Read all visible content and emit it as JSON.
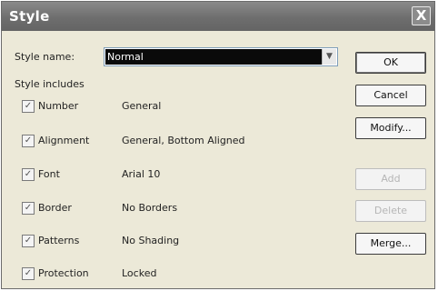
{
  "window": {
    "title": "Style",
    "close_glyph": "X"
  },
  "style_name": {
    "label": "Style name:",
    "value": "Normal"
  },
  "includes_label": "Style includes",
  "options": [
    {
      "label": "Number",
      "value": "General",
      "checked": true
    },
    {
      "label": "Alignment",
      "value": "General, Bottom Aligned",
      "checked": true
    },
    {
      "label": "Font",
      "value": "Arial 10",
      "checked": true
    },
    {
      "label": "Border",
      "value": "No Borders",
      "checked": true
    },
    {
      "label": "Patterns",
      "value": "No Shading",
      "checked": true
    },
    {
      "label": "Protection",
      "value": "Locked",
      "checked": true
    }
  ],
  "buttons": {
    "ok": "OK",
    "cancel": "Cancel",
    "modify": "Modify...",
    "add": "Add",
    "delete": "Delete",
    "merge": "Merge..."
  },
  "icons": {
    "dropdown": "chevron-down-icon",
    "checkmark": "checkmark-icon",
    "close": "close-icon"
  }
}
